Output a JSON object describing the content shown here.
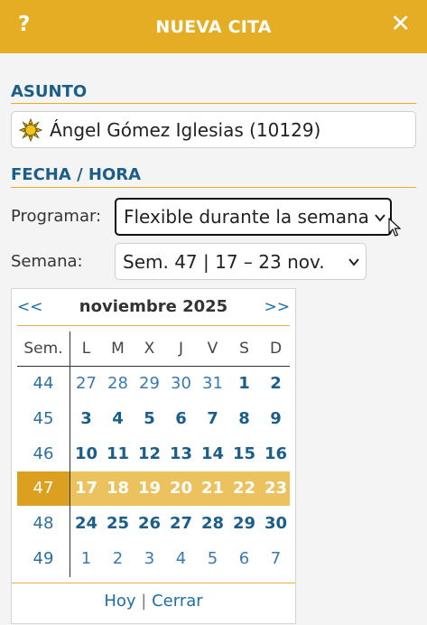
{
  "header": {
    "title": "NUEVA CITA",
    "help": "?",
    "close": "✕"
  },
  "asunto": {
    "heading": "ASUNTO",
    "icon": "sun-icon",
    "value": "Ángel Gómez Iglesias (10129)"
  },
  "fecha": {
    "heading": "FECHA / HORA",
    "programar_label": "Programar:",
    "programar_value": "Flexible durante la semana",
    "semana_label": "Semana:",
    "semana_value": "Sem. 47 | 17 – 23 nov."
  },
  "calendar": {
    "prev": "<<",
    "next": ">>",
    "month": "noviembre 2025",
    "headers": [
      "Sem.",
      "L",
      "M",
      "X",
      "J",
      "V",
      "S",
      "D"
    ],
    "rows": [
      {
        "week": "44",
        "days": [
          "27",
          "28",
          "29",
          "30",
          "31",
          "1",
          "2"
        ]
      },
      {
        "week": "45",
        "days": [
          "3",
          "4",
          "5",
          "6",
          "7",
          "8",
          "9"
        ]
      },
      {
        "week": "46",
        "days": [
          "10",
          "11",
          "12",
          "13",
          "14",
          "15",
          "16"
        ]
      },
      {
        "week": "47",
        "days": [
          "17",
          "18",
          "19",
          "20",
          "21",
          "22",
          "23"
        ]
      },
      {
        "week": "48",
        "days": [
          "24",
          "25",
          "26",
          "27",
          "28",
          "29",
          "30"
        ]
      },
      {
        "week": "49",
        "days": [
          "1",
          "2",
          "3",
          "4",
          "5",
          "6",
          "7"
        ]
      }
    ],
    "today": "Hoy",
    "separator": "|",
    "close": "Cerrar"
  },
  "colors": {
    "accent": "#e5ad24",
    "link": "#1b5e8a",
    "highlight_week": "#dca021",
    "highlight_days": "#ecc25e"
  }
}
